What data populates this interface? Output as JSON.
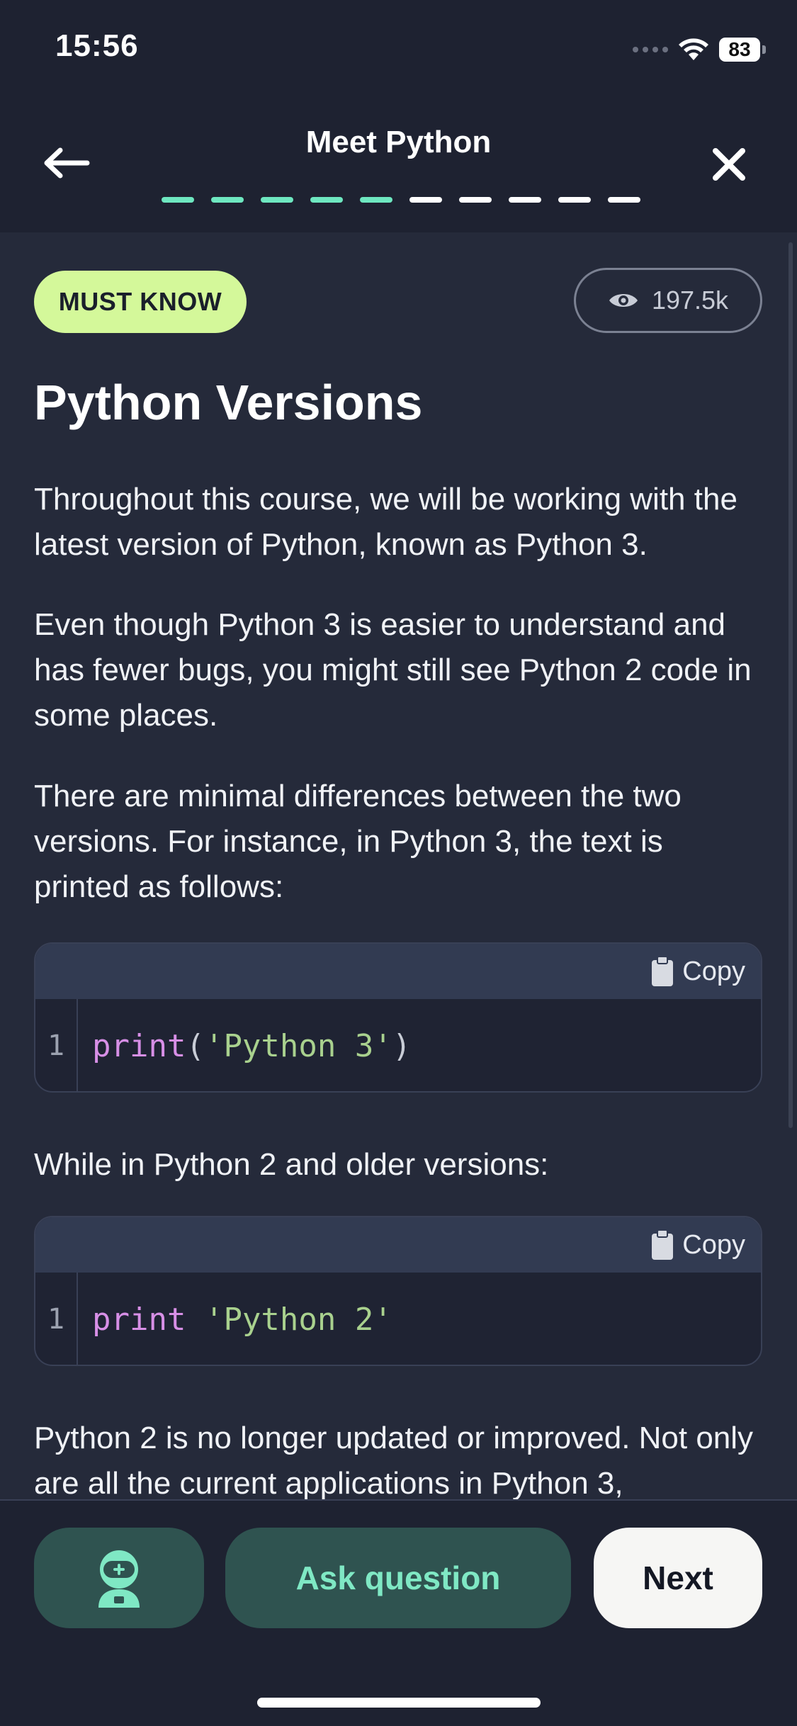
{
  "status_bar": {
    "time": "15:56",
    "battery": "83"
  },
  "header": {
    "title": "Meet Python",
    "progress": {
      "total": 10,
      "completed": 5
    },
    "back_icon": "arrow-left-icon",
    "close_icon": "close-icon"
  },
  "lesson": {
    "badge": "MUST KNOW",
    "views": "197.5k",
    "heading": "Python Versions",
    "paragraphs": [
      "Throughout this course, we will be working with the latest version of Python, known as Python 3.",
      "Even though Python 3 is easier to understand and has fewer bugs, you might still see Python 2 code in some places.",
      "There are minimal differences between the two versions. For instance, in Python 3, the text is printed as follows:",
      "While in Python 2 and older versions:",
      "Python 2 is no longer updated or improved. Not only are all the current applications in Python 3,"
    ],
    "code_blocks": [
      {
        "copy_label": "Copy",
        "line_number": "1",
        "keyword": "print",
        "open": "(",
        "string": "'Python 3'",
        "close": ")"
      },
      {
        "copy_label": "Copy",
        "line_number": "1",
        "keyword": "print",
        "space": " ",
        "string": "'Python 2'"
      }
    ]
  },
  "footer": {
    "ask_label": "Ask question",
    "next_label": "Next",
    "assistant_icon": "robot-assistant-icon"
  },
  "colors": {
    "background": "#252a3a",
    "header_background": "#1e2231",
    "accent_green": "#6ee7c0",
    "badge_background": "#d4f89a",
    "button_dark_green": "#2f5350",
    "keyword": "#d78fe6",
    "string": "#a9d18e"
  }
}
